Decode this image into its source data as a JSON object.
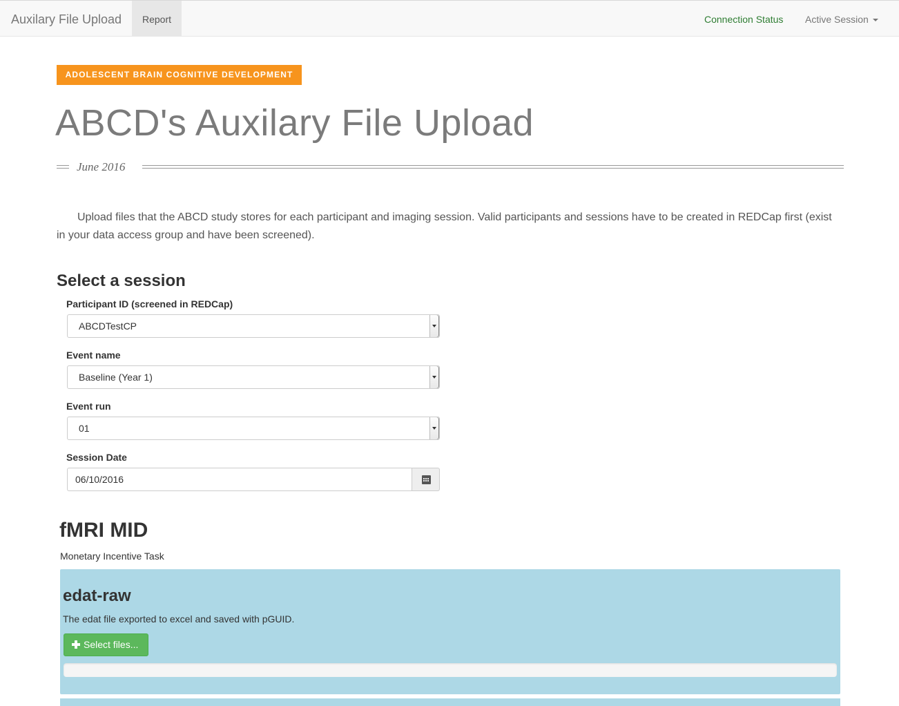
{
  "navbar": {
    "brand": "Auxilary File Upload",
    "report_label": "Report",
    "connection_status_label": "Connection Status",
    "active_session_label": "Active Session"
  },
  "header": {
    "badge": "ADOLESCENT BRAIN COGNITIVE DEVELOPMENT",
    "title": "ABCD's Auxilary File Upload",
    "date": "June 2016"
  },
  "intro": {
    "text": "Upload files that the ABCD study stores for each participant and imaging session. Valid participants and sessions have to be created in REDCap first (exist in your data access group and have been screened)."
  },
  "session": {
    "heading": "Select a session",
    "participant_label": "Participant ID (screened in REDCap)",
    "participant_value": "ABCDTestCP",
    "event_name_label": "Event name",
    "event_name_value": "Baseline (Year 1)",
    "event_run_label": "Event run",
    "event_run_value": "01",
    "session_date_label": "Session Date",
    "session_date_value": "06/10/2016"
  },
  "task": {
    "title": "fMRI MID",
    "subtitle": "Monetary Incentive Task",
    "uploads": [
      {
        "title": "edat-raw",
        "description": "The edat file exported to excel and saved with pGUID.",
        "button_label": "Select files...",
        "progress": 0
      }
    ]
  },
  "icons": {
    "calendar": "calendar-icon",
    "plus": "plus-icon",
    "caret": "caret-down-icon"
  },
  "colors": {
    "badge": "#f7941d",
    "connection_status": "#2e7d32",
    "panel": "#add8e6",
    "button": "#5cb85c"
  }
}
